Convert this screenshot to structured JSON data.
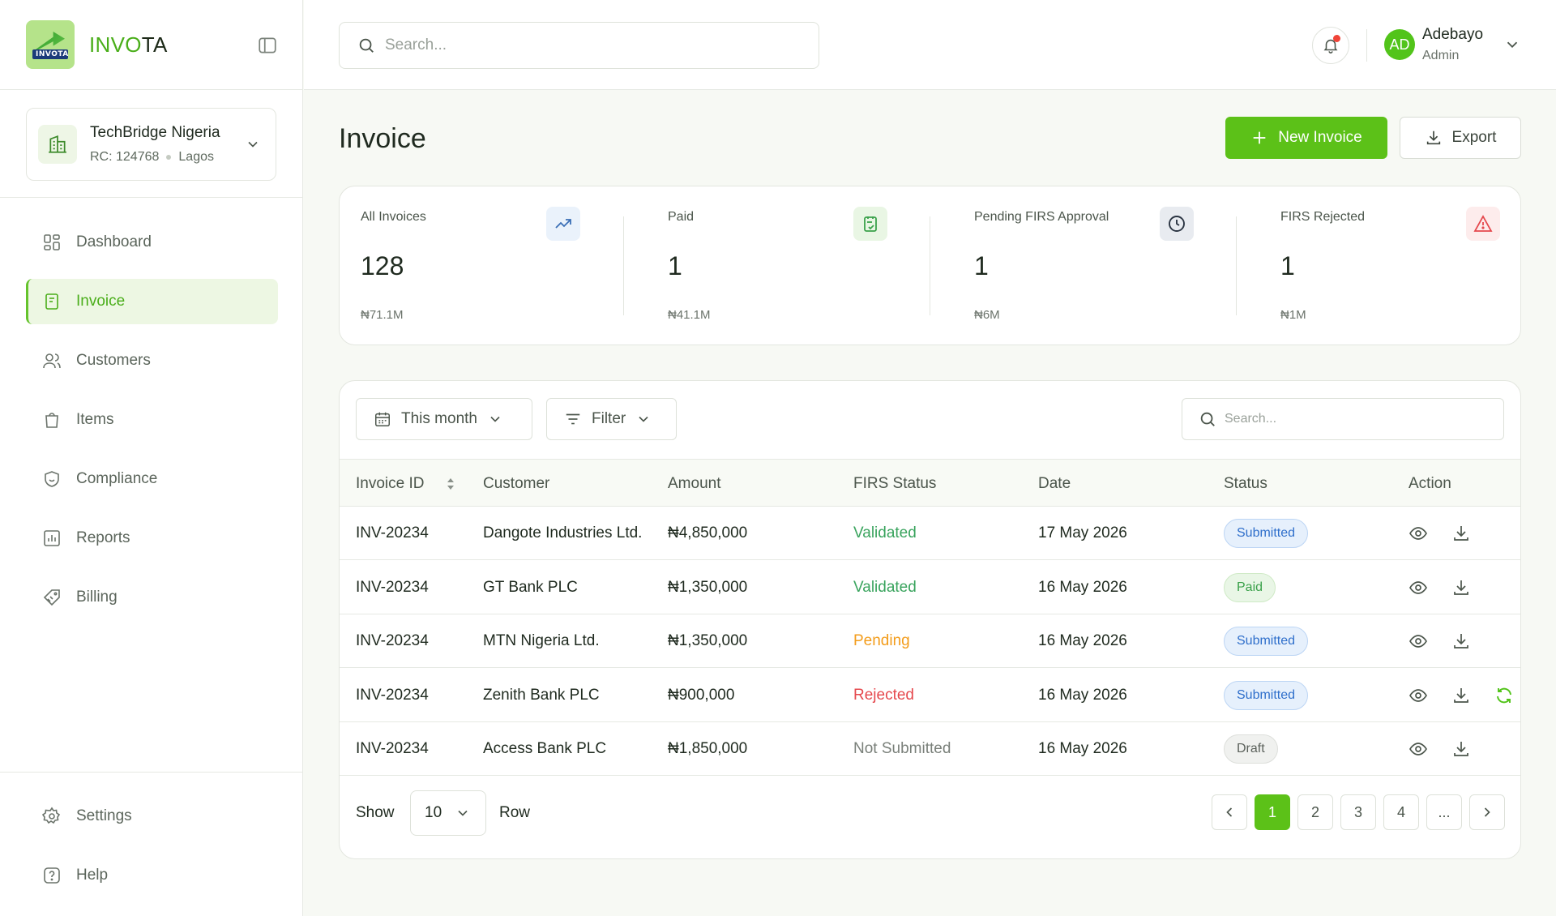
{
  "brand": {
    "name_prefix": "INVO",
    "name_suffix": "TA",
    "logo_text": "INVOTA"
  },
  "org": {
    "name": "TechBridge Nigeria",
    "rc": "RC: 124768",
    "location": "Lagos"
  },
  "nav": {
    "items": [
      {
        "label": "Dashboard",
        "icon": "grid-icon"
      },
      {
        "label": "Invoice",
        "icon": "receipt-icon",
        "active": true
      },
      {
        "label": "Customers",
        "icon": "users-icon"
      },
      {
        "label": "Items",
        "icon": "bag-icon"
      },
      {
        "label": "Compliance",
        "icon": "shield-icon"
      },
      {
        "label": "Reports",
        "icon": "chart-icon"
      },
      {
        "label": "Billing",
        "icon": "tag-icon"
      }
    ],
    "bottom": [
      {
        "label": "Settings",
        "icon": "gear-icon"
      },
      {
        "label": "Help",
        "icon": "help-icon"
      }
    ]
  },
  "topbar": {
    "search_placeholder": "Search...",
    "user": {
      "initials": "AD",
      "name": "Adebayo",
      "role": "Admin"
    }
  },
  "page": {
    "title": "Invoice",
    "new_invoice_label": "New Invoice",
    "export_label": "Export"
  },
  "stats": [
    {
      "label": "All Invoices",
      "value": "128",
      "sub": "₦71.1M",
      "icon": "trend-up-icon",
      "icon_bg": "#eaf2fb",
      "icon_color": "#3b6fb6"
    },
    {
      "label": "Paid",
      "value": "1",
      "sub": "₦41.1M",
      "icon": "paid-check-icon",
      "icon_bg": "#e9f6e4",
      "icon_color": "#3aa14a"
    },
    {
      "label": "Pending FIRS Approval",
      "value": "1",
      "sub": "₦6M",
      "icon": "clock-icon",
      "icon_bg": "#e8ebf0",
      "icon_color": "#2a3442"
    },
    {
      "label": "FIRS Rejected",
      "value": "1",
      "sub": "₦1M",
      "icon": "warning-icon",
      "icon_bg": "#fdecec",
      "icon_color": "#e5484d"
    }
  ],
  "table": {
    "period_label": "This month",
    "filter_label": "Filter",
    "search_placeholder": "Search...",
    "columns": [
      "Invoice ID",
      "Customer",
      "Amount",
      "FIRS Status",
      "Date",
      "Status",
      "Action"
    ],
    "rows": [
      {
        "id": "INV-20234",
        "customer": "Dangote Industries Ltd.",
        "amount": "₦4,850,000",
        "firs": "Validated",
        "firs_color": "#3aa45e",
        "date": "17 May 2026",
        "status": "Submitted",
        "status_bg": "#e6f0fc",
        "status_border": "#bcd5f4",
        "status_color": "#2f6fcb",
        "retry": false
      },
      {
        "id": "INV-20234",
        "customer": "GT Bank PLC",
        "amount": "₦1,350,000",
        "firs": "Validated",
        "firs_color": "#3aa45e",
        "date": "16 May 2026",
        "status": "Paid",
        "status_bg": "#e9f6e6",
        "status_border": "#cfeac6",
        "status_color": "#3aa14a",
        "retry": false
      },
      {
        "id": "INV-20234",
        "customer": "MTN Nigeria Ltd.",
        "amount": "₦1,350,000",
        "firs": "Pending",
        "firs_color": "#f39c1a",
        "date": "16 May 2026",
        "status": "Submitted",
        "status_bg": "#e6f0fc",
        "status_border": "#bcd5f4",
        "status_color": "#2f6fcb",
        "retry": false
      },
      {
        "id": "INV-20234",
        "customer": "Zenith Bank PLC",
        "amount": "₦900,000",
        "firs": "Rejected",
        "firs_color": "#e5484d",
        "date": "16 May 2026",
        "status": "Submitted",
        "status_bg": "#e6f0fc",
        "status_border": "#bcd5f4",
        "status_color": "#2f6fcb",
        "retry": true
      },
      {
        "id": "INV-20234",
        "customer": "Access Bank PLC",
        "amount": "₦1,850,000",
        "firs": "Not Submitted",
        "firs_color": "#7a807a",
        "date": "16 May 2026",
        "status": "Draft",
        "status_bg": "#f0f1ef",
        "status_border": "#dddfdb",
        "status_color": "#5b615b",
        "retry": false
      }
    ],
    "footer": {
      "show_label": "Show",
      "rows_value": "10",
      "row_label": "Row"
    },
    "pages": [
      "1",
      "2",
      "3",
      "4",
      "..."
    ],
    "current_page": 1
  },
  "colors": {
    "accent": "#5cc118",
    "accent_soft": "#edf7e3"
  }
}
